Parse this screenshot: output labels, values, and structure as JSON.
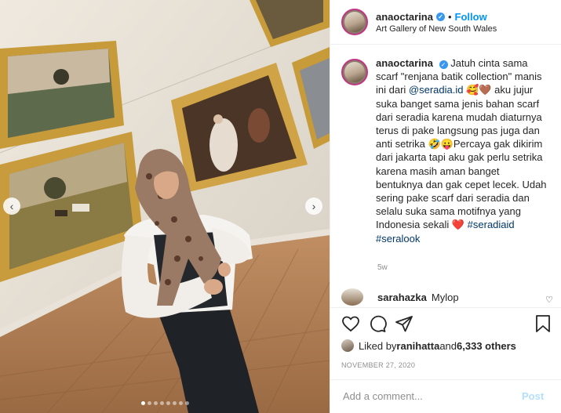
{
  "header": {
    "username": "anaoctarina",
    "separator": "•",
    "follow_label": "Follow",
    "location": "Art Gallery of New South Wales"
  },
  "caption": {
    "username": "anaoctarina",
    "text_1": "Jatuh cinta sama scarf \"renjana batik collection\" manis ini dari ",
    "mention": "@seradia.id",
    "emoji_1": "🥰🤎",
    "text_2": " aku jujur suka banget sama jenis bahan scarf dari seradia karena mudah diaturnya terus di pake langsung pas juga dan anti setrika ",
    "emoji_2": "🤣😛",
    "text_3": "Percaya gak dikirim dari jakarta tapi aku gak perlu setrika karena masih aman banget bentuknya dan gak cepet lecek. Udah sering pake scarf dari seradia dan selalu suka sama motifnya yang Indonesia sekali ",
    "emoji_3": "❤️",
    "hashtag_1": "#seradiaid",
    "hashtag_2": "#seralook",
    "age": "5w"
  },
  "comment": {
    "username": "sarahazka",
    "text": "Mylop"
  },
  "likes": {
    "prefix": "Liked by ",
    "user": "ranihatta",
    "middle": " and ",
    "count": "6,333 others"
  },
  "date": "NOVEMBER 27, 2020",
  "add_comment": {
    "placeholder": "Add a comment...",
    "post_label": "Post"
  },
  "carousel": {
    "prev_icon": "‹",
    "next_icon": "›",
    "slides": 8,
    "active": 0
  },
  "colors": {
    "link": "#00376b",
    "follow": "#0095f6",
    "verified": "#3897f0",
    "heart": "#ed4956"
  }
}
